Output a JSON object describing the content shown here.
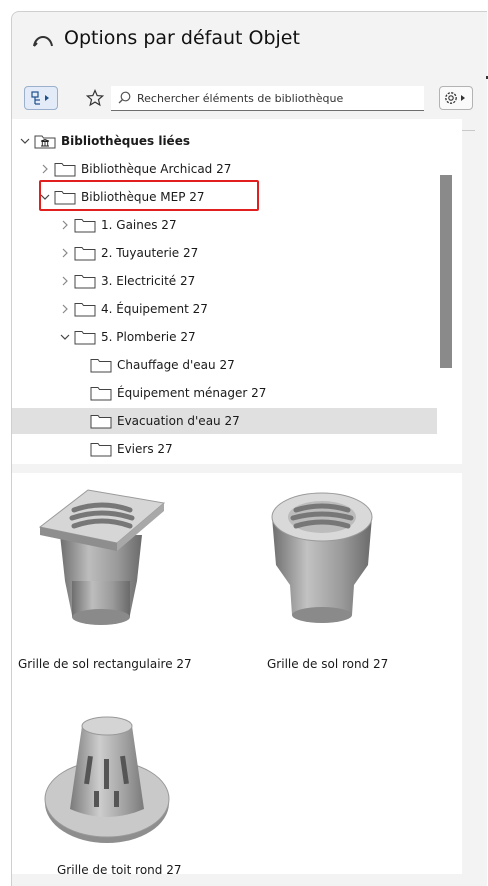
{
  "window": {
    "title": "Options par défaut Objet"
  },
  "toolbar": {
    "search_placeholder": "Rechercher éléments de bibliothèque",
    "icons": [
      "library-tree-icon",
      "star-icon",
      "search-icon",
      "settings-icon"
    ]
  },
  "tree": {
    "items": [
      {
        "label": "Bibliothèques liées",
        "level": 0,
        "expanded": true,
        "bold": true
      },
      {
        "label": "Bibliothèque Archicad 27",
        "level": 1,
        "expanded": false
      },
      {
        "label": "Bibliothèque MEP 27",
        "level": 1,
        "expanded": true,
        "highlighted": true
      },
      {
        "label": "1. Gaines 27",
        "level": 2,
        "expanded": false
      },
      {
        "label": "2. Tuyauterie 27",
        "level": 2,
        "expanded": false
      },
      {
        "label": "3. Electricité 27",
        "level": 2,
        "expanded": false
      },
      {
        "label": "4. Équipement 27",
        "level": 2,
        "expanded": false
      },
      {
        "label": "5. Plomberie 27",
        "level": 2,
        "expanded": true
      },
      {
        "label": "Chauffage d'eau 27",
        "level": 3
      },
      {
        "label": "Équipement ménager 27",
        "level": 3
      },
      {
        "label": "Evacuation d'eau 27",
        "level": 3,
        "selected": true
      },
      {
        "label": "Eviers 27",
        "level": 3
      }
    ]
  },
  "gallery": {
    "items": [
      {
        "label": "Grille de sol rectangulaire 27"
      },
      {
        "label": "Grille de sol rond 27"
      },
      {
        "label": "Grille de toit rond 27"
      }
    ]
  },
  "colors": {
    "highlight": "#e11f1f",
    "selection": "#e0e0e0",
    "panel": "#ffffff",
    "window": "#f3f3f3"
  }
}
